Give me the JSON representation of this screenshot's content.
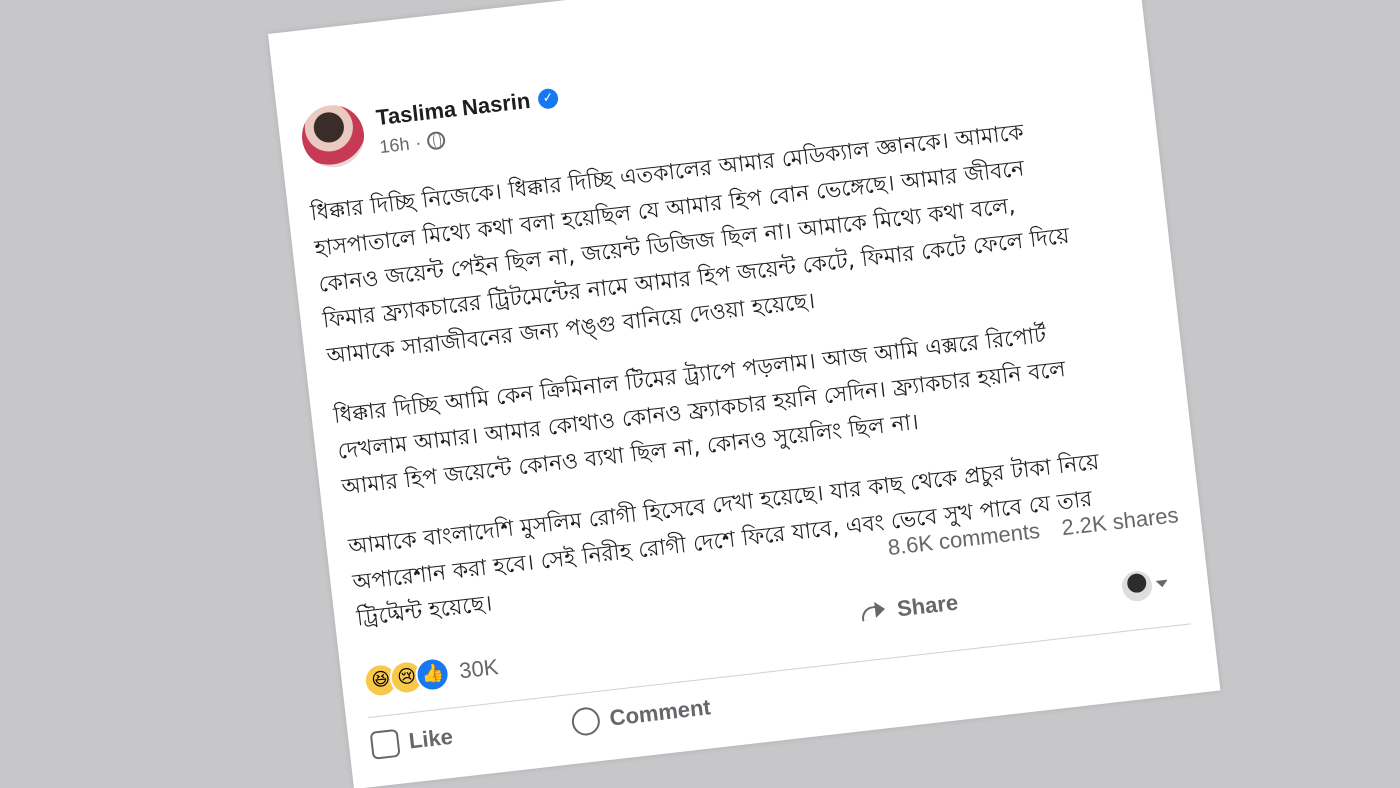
{
  "post": {
    "author": "Taslima Nasrin",
    "time": "16h",
    "body": [
      "ধিক্কার দিচ্ছি নিজেকে। ধিক্কার দিচ্ছি এতকালের আমার মেডিক্যাল জ্ঞানকে। আমাকে হাসপাতালে মিথ্যে কথা বলা হয়েছিল যে আমার হিপ বোন ভেঙ্গেছে। আমার জীবনে কোনও জয়েন্ট পেইন ছিল না, জয়েন্ট ডিজিজ ছিল না। আমাকে মিথ্যে কথা বলে, ফিমার ফ্র্যাকচারের ট্রিটমেন্টের নামে আমার হিপ জয়েন্ট কেটে, ফিমার কেটে ফেলে দিয়ে আমাকে সারাজীবনের জন্য পঙ্গু বানিয়ে দেওয়া হয়েছে।",
      "ধিক্কার দিচ্ছি আমি কেন ক্রিমিনাল টিমের ট্র্যাপে পড়লাম। আজ আমি এক্সরে রিপোর্ট দেখলাম আমার। আমার কোথাও কোনও ফ্র্যাকচার হয়নি সেদিন। ফ্র্যাকচার হয়নি বলে আমার হিপ জয়েন্টে কোনও ব্যথা ছিল না, কোনও সুয়েলিং ছিল না।",
      "আমাকে বাংলাদেশি মুসলিম রোগী হিসেবে দেখা হয়েছে। যার কাছ থেকে প্রচুর টাকা নিয়ে অপারেশান করা হবে। সেই নিরীহ রোগী দেশে ফিরে যাবে, এবং ভেবে সুখ পাবে যে তার ট্রিট্মেন্ট হয়েছে।"
    ]
  },
  "stats": {
    "comments": "8.6K comments",
    "shares": "2.2K shares",
    "reactions_count": "30K"
  },
  "actions": {
    "like": "Like",
    "comment": "Comment",
    "share": "Share"
  },
  "icons": {
    "more": "more-options-icon",
    "verified": "verified-badge-icon",
    "globe": "globe-icon"
  },
  "colors": {
    "verified": "#1877f2",
    "text": "#1c1e21",
    "muted": "#65676b",
    "background": "#c7c7c9"
  }
}
